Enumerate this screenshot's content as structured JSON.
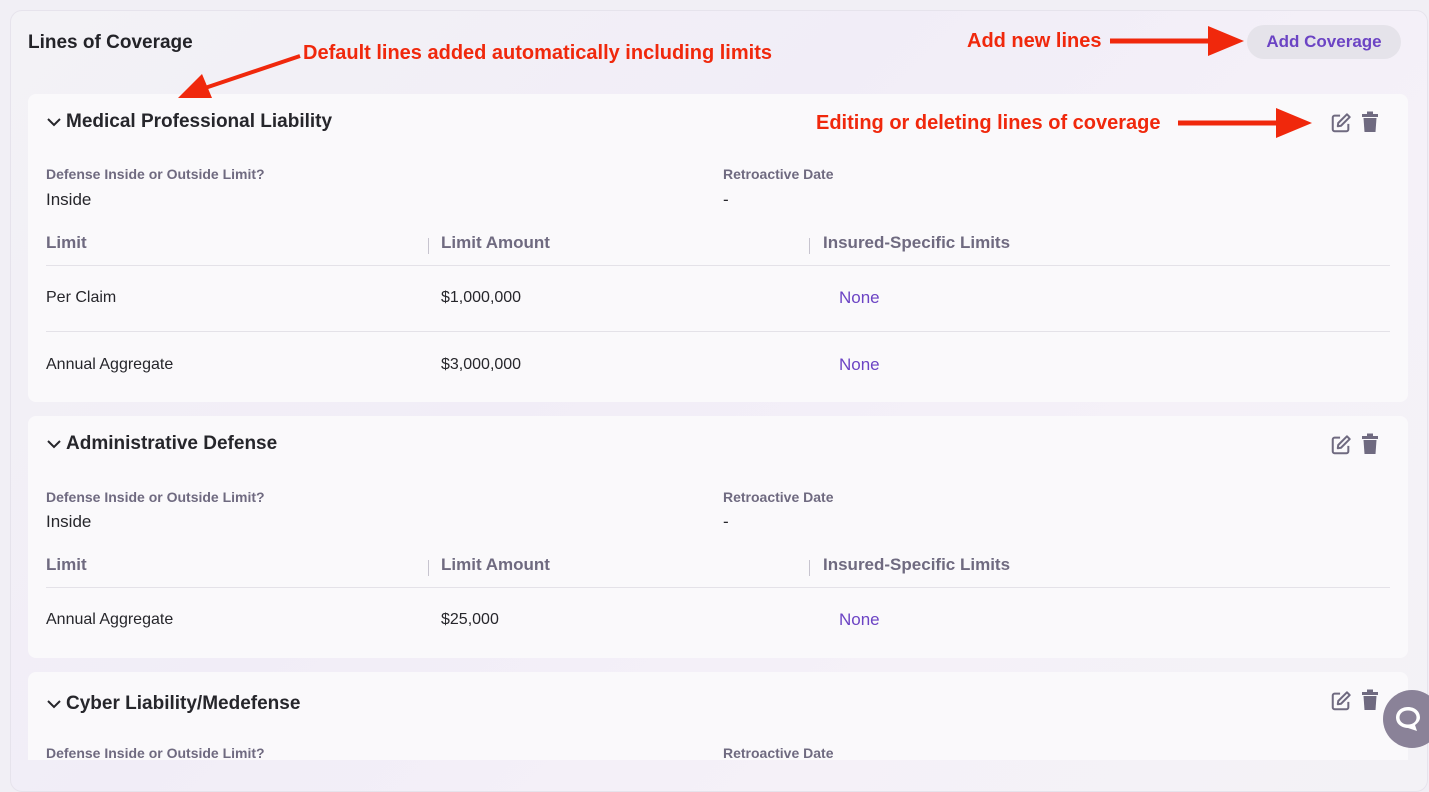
{
  "panel": {
    "title": "Lines of Coverage",
    "add_button_label": "Add Coverage"
  },
  "columns": {
    "limit": "Limit",
    "amount": "Limit Amount",
    "insured": "Insured-Specific Limits"
  },
  "fields": {
    "defense_label": "Defense Inside or Outside Limit?",
    "retro_label": "Retroactive Date"
  },
  "cards": [
    {
      "title": "Medical Professional Liability",
      "defense_value": "Inside",
      "retro_value": "-",
      "rows": [
        {
          "limit": "Per Claim",
          "amount": "$1,000,000",
          "insured": "None"
        },
        {
          "limit": "Annual Aggregate",
          "amount": "$3,000,000",
          "insured": "None"
        }
      ]
    },
    {
      "title": "Administrative Defense",
      "defense_value": "Inside",
      "retro_value": "-",
      "rows": [
        {
          "limit": "Annual Aggregate",
          "amount": "$25,000",
          "insured": "None"
        }
      ]
    },
    {
      "title": "Cyber Liability/Medefense"
    }
  ],
  "annotations": {
    "default_lines": "Default lines added automatically including limits",
    "add_new": "Add new lines",
    "edit_delete": "Editing or deleting lines of coverage"
  },
  "colors": {
    "accent": "#6c44c4",
    "annotation": "#f0280c",
    "muted_label": "#6f6a80",
    "card_bg": "#faf9fb"
  },
  "icons": [
    "chevron-down-icon",
    "edit-icon",
    "trash-icon",
    "chat-icon"
  ]
}
